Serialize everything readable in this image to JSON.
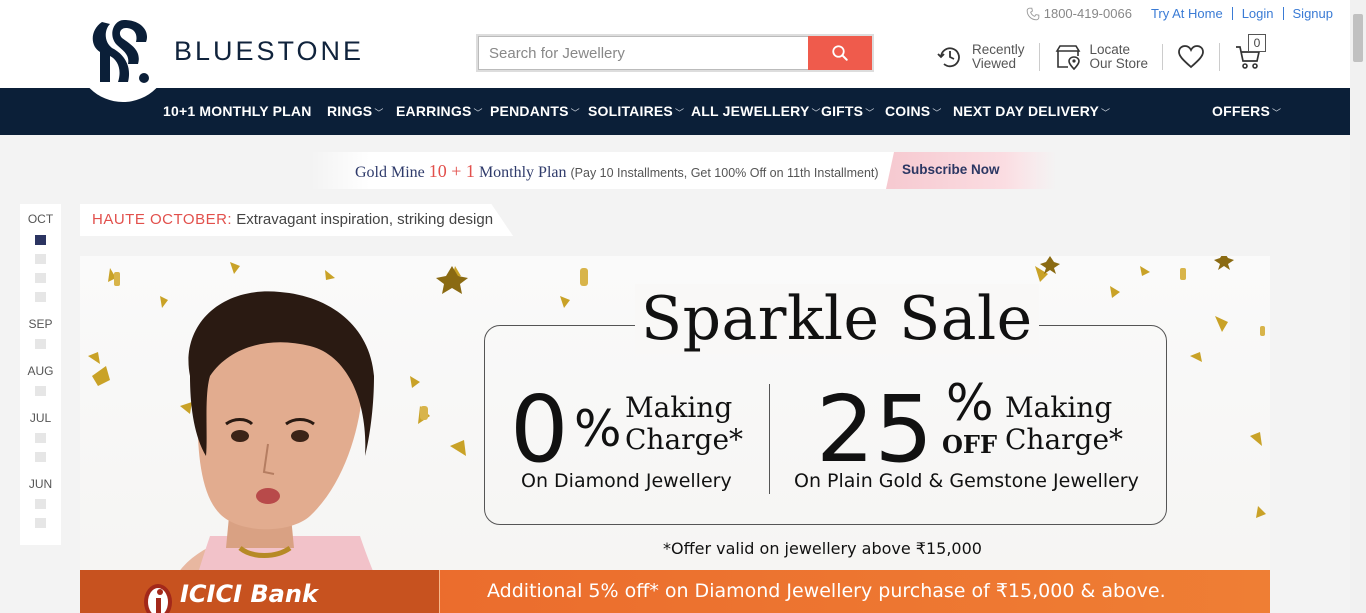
{
  "header": {
    "brand": "BLUESTONE",
    "phone": "1800-419-0066",
    "links": [
      "Try At Home",
      "Login",
      "Signup"
    ],
    "search_placeholder": "Search for Jewellery",
    "recently_viewed": [
      "Recently",
      "Viewed"
    ],
    "locate_store": [
      "Locate",
      "Our Store"
    ],
    "cart_count": "0"
  },
  "nav": {
    "items": [
      "10+1 MONTHLY PLAN",
      "RINGS",
      "EARRINGS",
      "PENDANTS",
      "SOLITAIRES",
      "ALL JEWELLERY",
      "GIFTS",
      "COINS",
      "NEXT DAY DELIVERY",
      "OFFERS"
    ]
  },
  "promo": {
    "lead": "Gold Mine ",
    "num": "10 + 1",
    "tail": " Monthly Plan ",
    "small": "(Pay 10 Installments, Get 100% Off on 11th Installment)",
    "cta": "Subscribe Now"
  },
  "months": [
    "OCT",
    "SEP",
    "AUG",
    "JUL",
    "JUN"
  ],
  "collection": {
    "highlight": "HAUTE OCTOBER:",
    "text": " Extravagant inspiration, striking design"
  },
  "banner": {
    "title": "Sparkle Sale",
    "left_big": "0",
    "left_pct": "%",
    "left_making": "Making",
    "left_charge": "Charge*",
    "left_sub": "On Diamond Jewellery",
    "right_big": "25",
    "right_pct": "%",
    "right_off": "OFF",
    "right_making": "Making",
    "right_charge": "Charge*",
    "right_sub": "On Plain Gold & Gemstone Jewellery",
    "validity": "*Offer valid on jewellery above ₹15,000",
    "bank": "ICICI Bank",
    "additional": "Additional 5% off* on Diamond Jewellery purchase of  ₹15,000 & above."
  },
  "colors": {
    "nav_bg": "#0b1f38",
    "search_button": "#ef5b4c",
    "accent_red": "#e2504c",
    "link_blue": "#3a7bd5",
    "offer_orange": "#ef7e34"
  },
  "icons": [
    "phone-icon",
    "search-icon",
    "history-icon",
    "store-location-icon",
    "heart-icon",
    "cart-icon"
  ]
}
